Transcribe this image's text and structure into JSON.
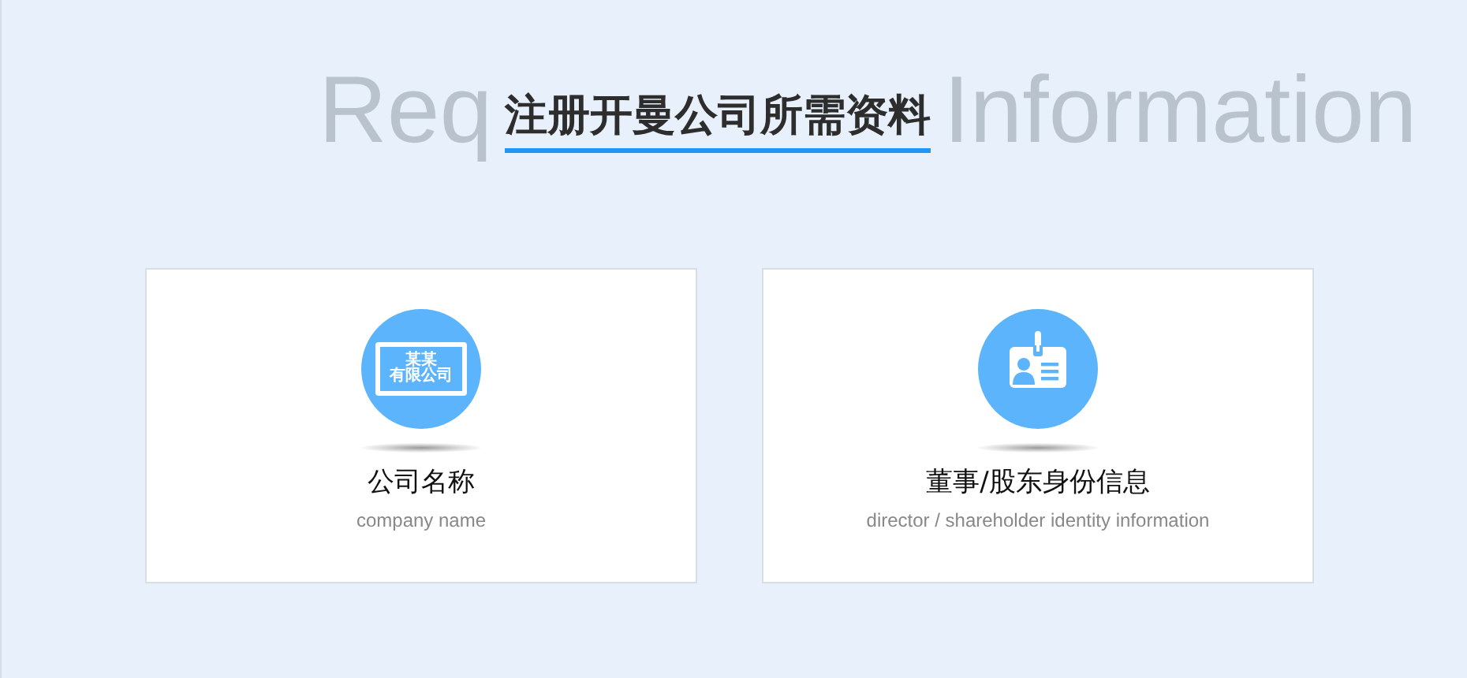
{
  "background_heading_parts": [
    "Req",
    "Information"
  ],
  "title": "注册开曼公司所需资料",
  "cards": [
    {
      "kind": "license",
      "icon_text": [
        "某某",
        "有限公司"
      ],
      "title": "公司名称",
      "subtitle": "company name"
    },
    {
      "kind": "id-badge",
      "title": "董事/股东身份信息",
      "subtitle": "director / shareholder identity information"
    }
  ]
}
